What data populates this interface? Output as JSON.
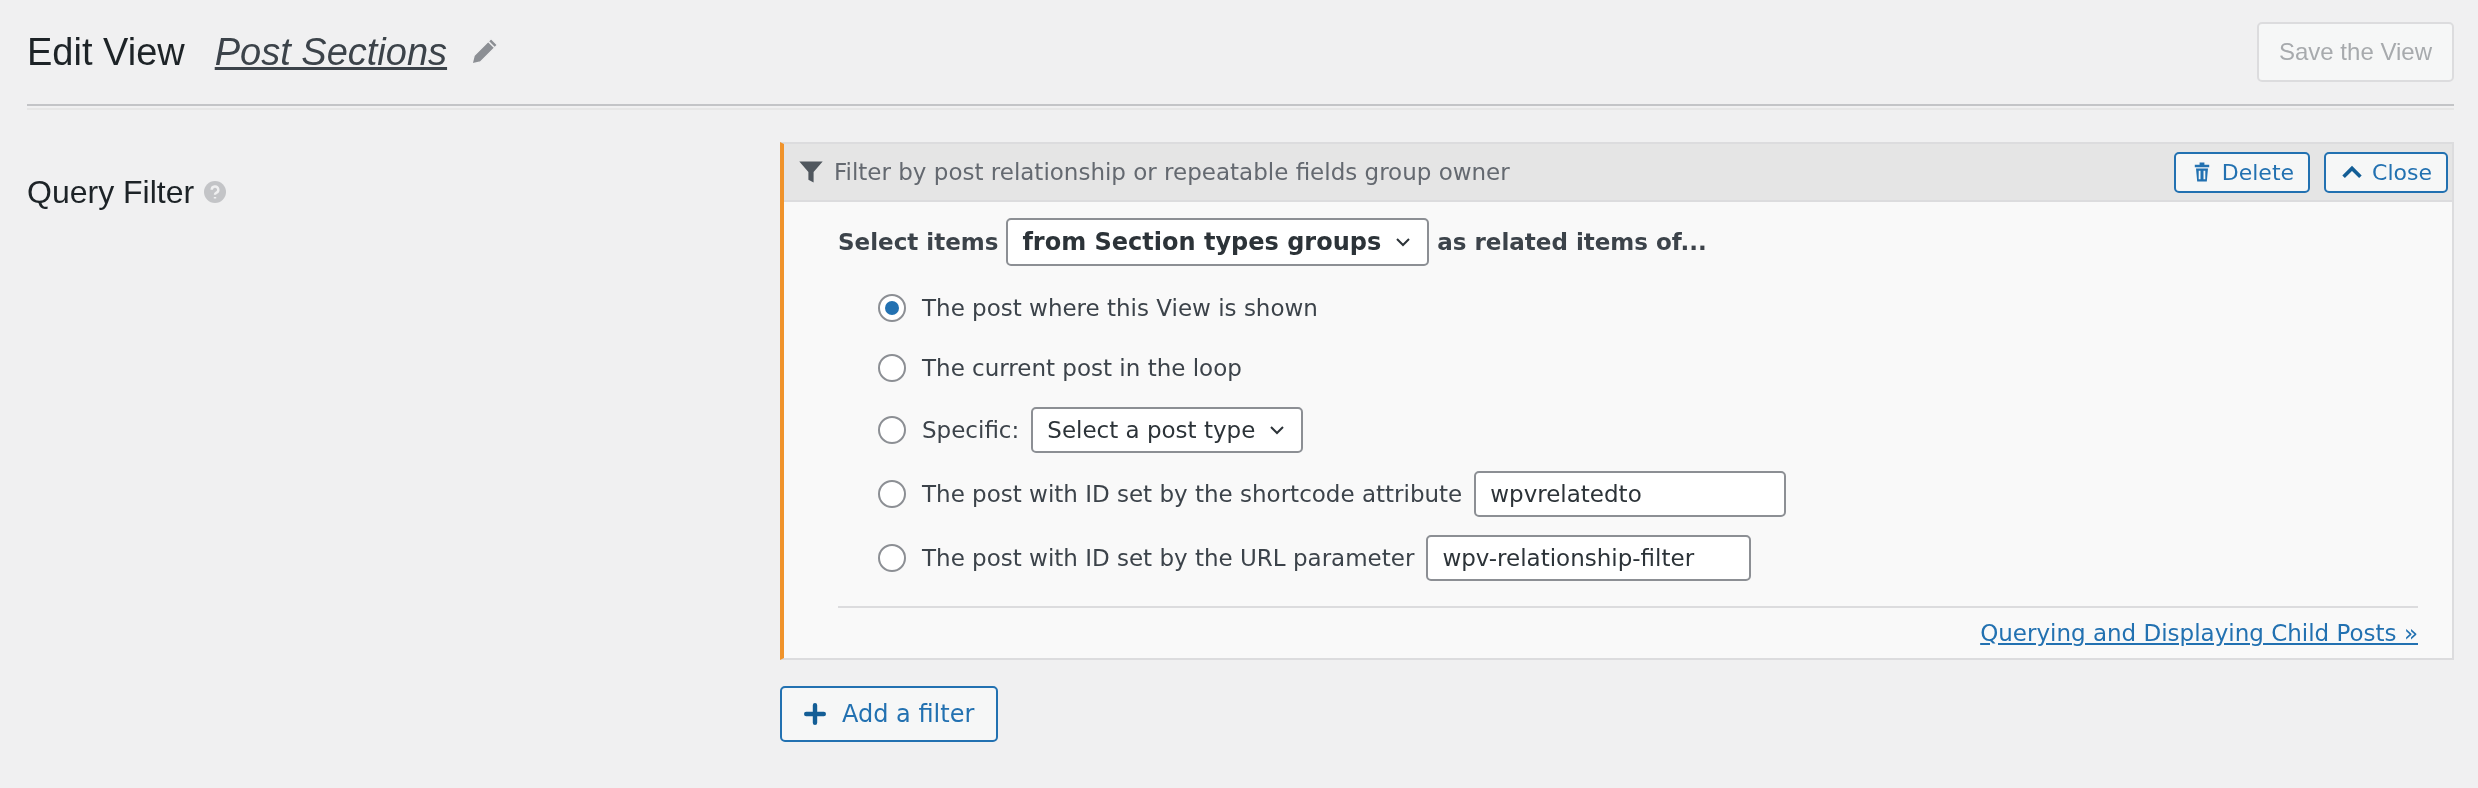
{
  "header": {
    "title": "Edit View",
    "view_name": "Post Sections",
    "save_button": {
      "label": "Save the View",
      "disabled": true
    }
  },
  "section": {
    "label": "Query Filter"
  },
  "filter": {
    "title": "Filter by post relationship or repeatable fields group owner",
    "delete_button": "Delete",
    "close_button": "Close",
    "select_label": "Select items",
    "select_value": "from Section types groups",
    "select_suffix": "as related items of...",
    "options": [
      {
        "kind": "plain",
        "label": "The post where this View is shown",
        "selected": true
      },
      {
        "kind": "plain",
        "label": "The current post in the loop",
        "selected": false
      },
      {
        "kind": "select",
        "label": "Specific:",
        "value": "Select a post type",
        "selected": false
      },
      {
        "kind": "input",
        "label": "The post with ID set by the shortcode attribute",
        "value": "wpvrelatedto",
        "selected": false
      },
      {
        "kind": "input",
        "label": "The post with ID set by the URL parameter",
        "value": "wpv-relationship-filter",
        "selected": false
      }
    ],
    "help_link": "Querying and Displaying Child Posts »"
  },
  "add_filter_button": "Add a filter"
}
